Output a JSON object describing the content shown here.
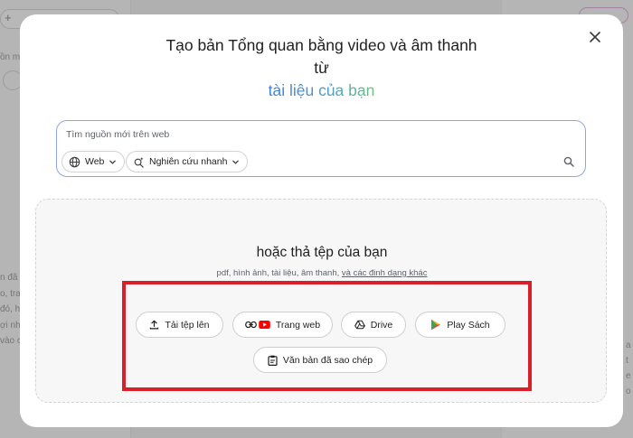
{
  "background": {
    "left_texts": [
      "ồn m",
      "n đã",
      "o, tra",
      "đó, h",
      "ợi nh",
      "vào c"
    ],
    "right_texts": [
      "a",
      "t",
      "e",
      "o"
    ]
  },
  "dialog": {
    "title_line1": "Tạo bản Tổng quan bằng video và âm thanh",
    "title_line2": "từ",
    "title_line3": "tài liệu của bạn",
    "close_icon": "close-icon"
  },
  "search": {
    "placeholder": "Tìm nguồn mới trên web",
    "chip_web_label": "Web",
    "chip_research_label": "Nghiên cứu nhanh"
  },
  "dropzone": {
    "title": "hoặc thả tệp của bạn",
    "subtitle": "pdf, hình ảnh, tài liệu, âm thanh, ",
    "subtitle_link": "và các định dạng khác"
  },
  "sources": {
    "upload": "Tải tệp lên",
    "website": "Trang web",
    "drive": "Drive",
    "play_books": "Play Sách",
    "copied_text": "Văn bản đã sao chép"
  },
  "colors": {
    "accent": "#4a82d8",
    "highlight": "#d9202a",
    "youtube": "#ff0000"
  }
}
